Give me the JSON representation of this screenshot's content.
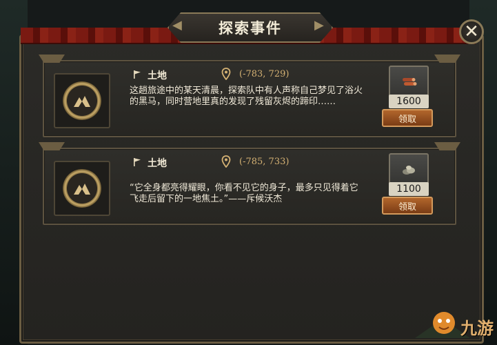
{
  "dialog": {
    "title": "探索事件"
  },
  "events": [
    {
      "land_label": "土地",
      "coords": "(-783, 729)",
      "description": "这趟旅途中的某天清晨，探索队中有人声称自己梦见了浴火的黑马，同时营地里真的发现了残留灰烬的蹄印……",
      "reward_icon": "wood-logs-icon",
      "reward_qty": "1600",
      "claim_label": "领取"
    },
    {
      "land_label": "土地",
      "coords": "(-785, 733)",
      "description": "“它全身都亮得耀眼，你看不见它的身子，最多只见得着它飞走后留下的一地焦土。”——斥候沃杰",
      "reward_icon": "stone-ore-icon",
      "reward_qty": "1100",
      "claim_label": "领取"
    }
  ],
  "watermark": {
    "text": "九游"
  },
  "colors": {
    "accent_gold": "#d4b173",
    "button_orange": "#b2662c",
    "frame_bronze": "#6b5d42"
  }
}
